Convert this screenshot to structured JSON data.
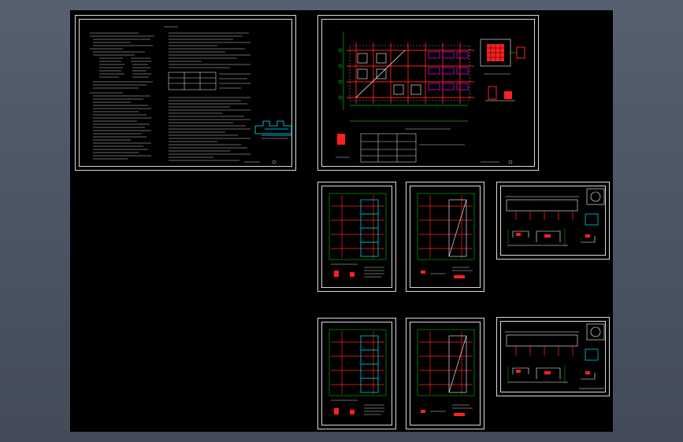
{
  "app": {
    "title": "",
    "view": "model-space"
  },
  "colors": {
    "background": "#000000",
    "border": "#d9d9d9",
    "text": "#ffffff",
    "grid": "#ff2020",
    "axis": "#00c000",
    "detail": "#00e5ff",
    "highlight": "#ff00ff"
  },
  "sheets": [
    {
      "id": "notes-sheet",
      "kind": "general-notes"
    },
    {
      "id": "foundation-plan-sheet",
      "kind": "plan-with-details"
    },
    {
      "id": "floor-plan-1",
      "kind": "plan"
    },
    {
      "id": "floor-plan-2",
      "kind": "plan"
    },
    {
      "id": "detail-sheet-1",
      "kind": "details"
    },
    {
      "id": "floor-plan-3",
      "kind": "plan"
    },
    {
      "id": "floor-plan-4",
      "kind": "plan"
    },
    {
      "id": "detail-sheet-2",
      "kind": "details"
    }
  ]
}
